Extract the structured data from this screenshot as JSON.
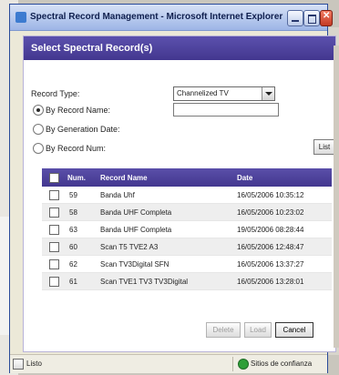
{
  "window": {
    "title": "Spectral Record Management - Microsoft Internet Explorer"
  },
  "dialog": {
    "title": "Select Spectral Record(s)",
    "record_type_label": "Record Type:",
    "record_type_value": "Channelized TV",
    "options": [
      {
        "label": "By Record Name:",
        "selected": true
      },
      {
        "label": "By Generation Date:",
        "selected": false
      },
      {
        "label": "By Record Num:",
        "selected": false
      }
    ],
    "record_name_value": "",
    "list_button": "List",
    "table": {
      "headers": [
        "Num.",
        "Record Name",
        "Date"
      ],
      "rows": [
        {
          "num": "59",
          "name": "Banda Uhf",
          "date": "16/05/2006 10:35:12"
        },
        {
          "num": "58",
          "name": "Banda UHF Completa",
          "date": "16/05/2006 10:23:02"
        },
        {
          "num": "63",
          "name": "Banda UHF Completa",
          "date": "19/05/2006 08:28:44"
        },
        {
          "num": "60",
          "name": "Scan T5 TVE2 A3",
          "date": "16/05/2006 12:48:47"
        },
        {
          "num": "62",
          "name": "Scan TV3Digital SFN",
          "date": "16/05/2006 13:37:27"
        },
        {
          "num": "61",
          "name": "Scan TVE1 TV3 TV3Digital",
          "date": "16/05/2006 13:28:01"
        }
      ]
    },
    "buttons": {
      "delete": "Delete",
      "load": "Load",
      "cancel": "Cancel"
    }
  },
  "statusbar": {
    "text": "Listo",
    "zone": "Sitios de confianza"
  },
  "colors": {
    "dialog_header": "#4b3f9a",
    "table_header": "#4b3f9a",
    "titlebar": "#b9cbee"
  },
  "icons": {
    "window": "ie-icon",
    "trust": "trusted-sites-icon"
  }
}
